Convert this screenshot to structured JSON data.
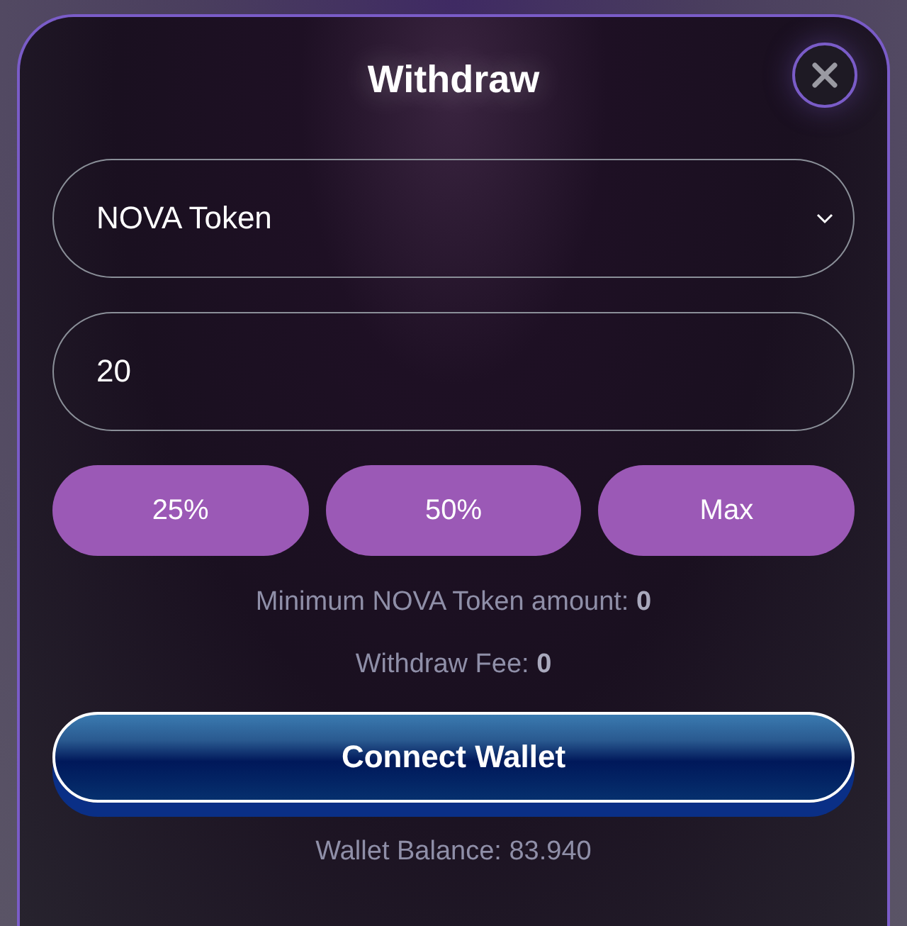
{
  "dialog": {
    "title": "Withdraw"
  },
  "token_select": {
    "value": "NOVA Token"
  },
  "amount_field": {
    "value": "20"
  },
  "presets": [
    "25%",
    "50%",
    "Max"
  ],
  "info": [
    "Minimum NOVA Token amount: **0**",
    "Withdraw Fee: **0**"
  ],
  "connect_button": "Connect Wallet",
  "wallet_balance": "Wallet Balance: 83.940"
}
